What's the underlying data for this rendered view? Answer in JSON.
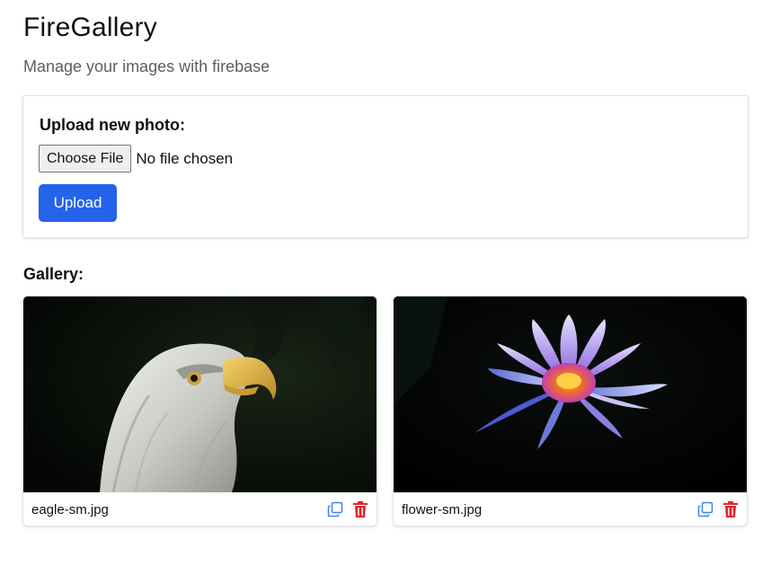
{
  "header": {
    "title": "FireGallery",
    "subtitle": "Manage your images with firebase"
  },
  "upload": {
    "label": "Upload new photo:",
    "choose_file_label": "Choose File",
    "file_status": "No file chosen",
    "upload_button": "Upload"
  },
  "gallery": {
    "heading": "Gallery:",
    "items": [
      {
        "filename": "eagle-sm.jpg",
        "image": "bald eagle head on dark background",
        "actions": [
          "copy-icon",
          "trash-icon"
        ]
      },
      {
        "filename": "flower-sm.jpg",
        "image": "purple water lily on black background",
        "actions": [
          "copy-icon",
          "trash-icon"
        ]
      }
    ]
  },
  "colors": {
    "primary": "#2563eb",
    "copy_icon": "#3b82f6",
    "delete_icon": "#dc2626",
    "subtitle": "#5b5f66"
  }
}
